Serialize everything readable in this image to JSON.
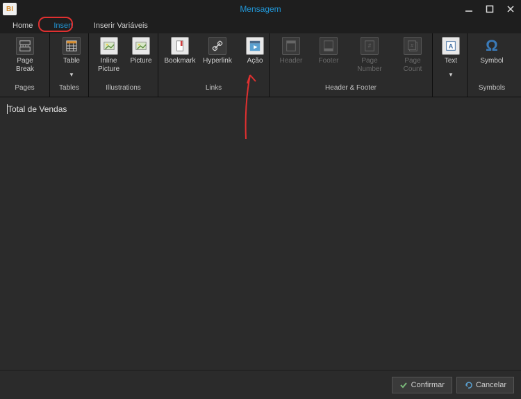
{
  "window": {
    "title": "Mensagem",
    "logo_text": "BI"
  },
  "tabs": {
    "home": "Home",
    "insert": "Insert",
    "vars": "Inserir Variáveis"
  },
  "ribbon": {
    "groups": {
      "pages": {
        "label": "Pages",
        "page_break": "Page Break"
      },
      "tables": {
        "label": "Tables",
        "table": "Table"
      },
      "illustrations": {
        "label": "Illustrations",
        "inline_picture": "Inline Picture",
        "picture": "Picture"
      },
      "links": {
        "label": "Links",
        "bookmark": "Bookmark",
        "hyperlink": "Hyperlink",
        "action": "Ação"
      },
      "header_footer": {
        "label": "Header & Footer",
        "header": "Header",
        "footer": "Footer",
        "page_number": "Page Number",
        "page_count": "Page Count"
      },
      "text_group": {
        "label": "",
        "text": "Text"
      },
      "symbols": {
        "label": "Symbols",
        "symbol": "Symbol"
      }
    }
  },
  "editor": {
    "content": "Total de Vendas"
  },
  "footer": {
    "confirm": "Confirmar",
    "cancel": "Cancelar"
  }
}
